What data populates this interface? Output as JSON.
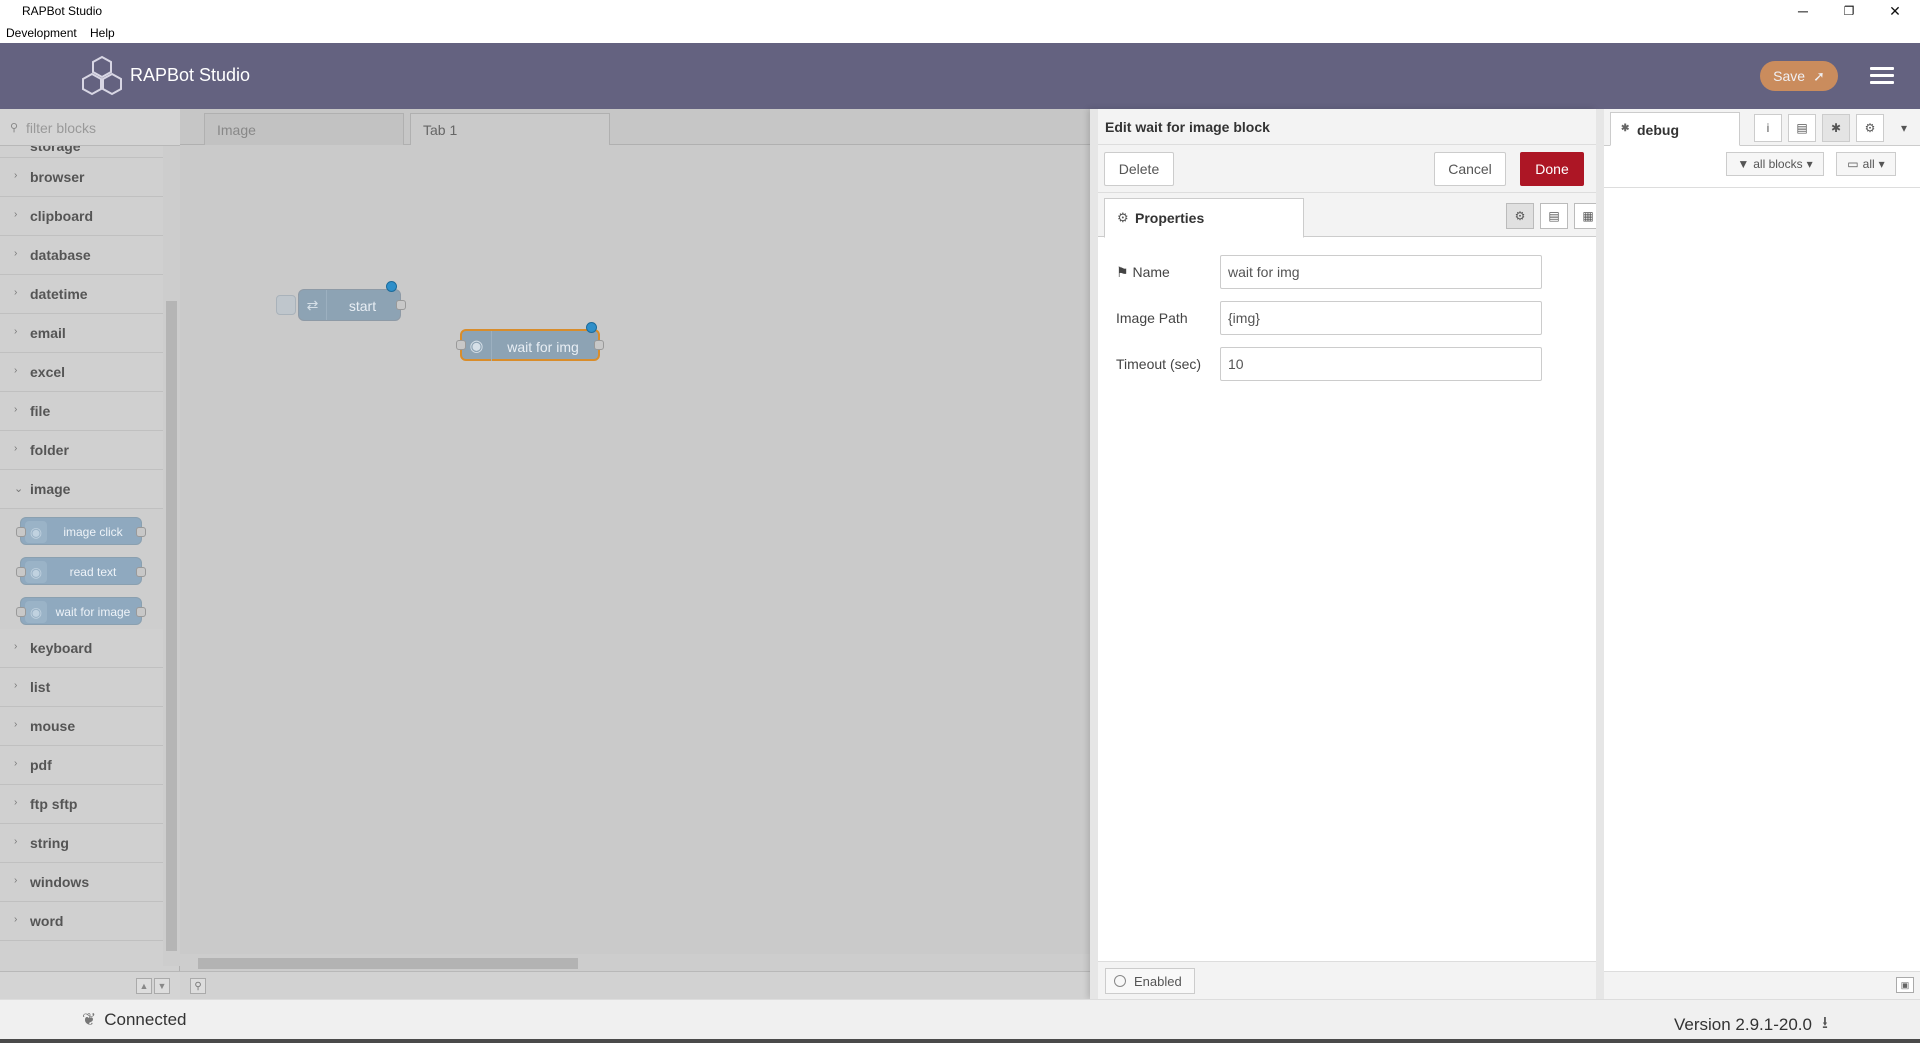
{
  "window": {
    "title": "RAPBot Studio",
    "minimize_glyph": "─",
    "maximize_glyph": "❐",
    "close_glyph": "✕"
  },
  "menubar": {
    "items": [
      "Development",
      "Help"
    ]
  },
  "header": {
    "brand": "RAPBot Studio",
    "save_label": "Save",
    "accent_color": "#d6915a",
    "header_color": "#646280"
  },
  "palette": {
    "filter_placeholder": "filter blocks",
    "partial_top_category": "storage",
    "categories_before": [
      "browser",
      "clipboard",
      "database",
      "datetime",
      "email",
      "excel",
      "file",
      "folder"
    ],
    "open_category": "image",
    "image_blocks": [
      "image click",
      "read text",
      "wait for image"
    ],
    "categories_after": [
      "keyboard",
      "list",
      "mouse",
      "pdf",
      "ftp sftp",
      "string",
      "windows",
      "word"
    ]
  },
  "workspace": {
    "tabs": [
      "Image",
      "Tab 1"
    ],
    "active_tab": "Tab 1",
    "nodes": {
      "start": "start",
      "wait": "wait for img"
    }
  },
  "editor": {
    "title": "Edit wait for image block",
    "delete_label": "Delete",
    "cancel_label": "Cancel",
    "done_label": "Done",
    "done_color": "#ad1625",
    "properties_tab": "Properties",
    "fields": {
      "name_label": "Name",
      "name_value": "wait for img",
      "path_label": "Image Path",
      "path_value": "{img}",
      "timeout_label": "Timeout (sec)",
      "timeout_value": "10"
    },
    "enabled_label": "Enabled"
  },
  "sidebar": {
    "debug_tab": "debug",
    "filter_label": "all blocks",
    "clear_label": "all"
  },
  "status": {
    "connection": "Connected",
    "version": "Version 2.9.1-20.0"
  }
}
